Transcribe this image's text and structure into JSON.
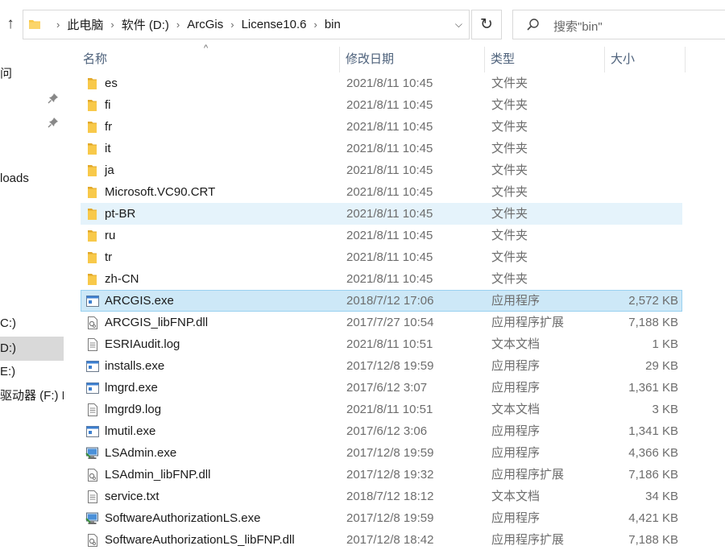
{
  "address_bar": {
    "crumbs": [
      "此电脑",
      "软件 (D:)",
      "ArcGis",
      "License10.6",
      "bin"
    ]
  },
  "search": {
    "placeholder": "搜索\"bin\""
  },
  "nav": {
    "items": [
      {
        "label": "问",
        "selected": false
      },
      {
        "label": "loads",
        "selected": false
      },
      {
        "label": "C:)",
        "selected": false
      },
      {
        "label": "D:)",
        "selected": true
      },
      {
        "label": "E:)",
        "selected": false
      },
      {
        "label": "驱动器 (F:) E",
        "selected": false
      }
    ]
  },
  "columns": {
    "name": "名称",
    "date": "修改日期",
    "type": "类型",
    "size": "大小"
  },
  "files": [
    {
      "name": "es",
      "date": "2021/8/11 10:45",
      "type": "文件夹",
      "size": "",
      "icon": "folder-icon",
      "state": ""
    },
    {
      "name": "fi",
      "date": "2021/8/11 10:45",
      "type": "文件夹",
      "size": "",
      "icon": "folder-icon",
      "state": ""
    },
    {
      "name": "fr",
      "date": "2021/8/11 10:45",
      "type": "文件夹",
      "size": "",
      "icon": "folder-icon",
      "state": ""
    },
    {
      "name": "it",
      "date": "2021/8/11 10:45",
      "type": "文件夹",
      "size": "",
      "icon": "folder-icon",
      "state": ""
    },
    {
      "name": "ja",
      "date": "2021/8/11 10:45",
      "type": "文件夹",
      "size": "",
      "icon": "folder-icon",
      "state": ""
    },
    {
      "name": "Microsoft.VC90.CRT",
      "date": "2021/8/11 10:45",
      "type": "文件夹",
      "size": "",
      "icon": "folder-icon",
      "state": ""
    },
    {
      "name": "pt-BR",
      "date": "2021/8/11 10:45",
      "type": "文件夹",
      "size": "",
      "icon": "folder-icon",
      "state": "hover"
    },
    {
      "name": "ru",
      "date": "2021/8/11 10:45",
      "type": "文件夹",
      "size": "",
      "icon": "folder-icon",
      "state": ""
    },
    {
      "name": "tr",
      "date": "2021/8/11 10:45",
      "type": "文件夹",
      "size": "",
      "icon": "folder-icon",
      "state": ""
    },
    {
      "name": "zh-CN",
      "date": "2021/8/11 10:45",
      "type": "文件夹",
      "size": "",
      "icon": "folder-icon",
      "state": ""
    },
    {
      "name": "ARCGIS.exe",
      "date": "2018/7/12 17:06",
      "type": "应用程序",
      "size": "2,572 KB",
      "icon": "exe-icon",
      "state": "selected"
    },
    {
      "name": "ARCGIS_libFNP.dll",
      "date": "2017/7/27 10:54",
      "type": "应用程序扩展",
      "size": "7,188 KB",
      "icon": "dll-icon",
      "state": ""
    },
    {
      "name": "ESRIAudit.log",
      "date": "2021/8/11 10:51",
      "type": "文本文档",
      "size": "1 KB",
      "icon": "text-file-icon",
      "state": ""
    },
    {
      "name": "installs.exe",
      "date": "2017/12/8 19:59",
      "type": "应用程序",
      "size": "29 KB",
      "icon": "exe-icon",
      "state": ""
    },
    {
      "name": "lmgrd.exe",
      "date": "2017/6/12 3:07",
      "type": "应用程序",
      "size": "1,361 KB",
      "icon": "exe-icon",
      "state": ""
    },
    {
      "name": "lmgrd9.log",
      "date": "2021/8/11 10:51",
      "type": "文本文档",
      "size": "3 KB",
      "icon": "text-file-icon",
      "state": ""
    },
    {
      "name": "lmutil.exe",
      "date": "2017/6/12 3:06",
      "type": "应用程序",
      "size": "1,341 KB",
      "icon": "exe-icon",
      "state": ""
    },
    {
      "name": "LSAdmin.exe",
      "date": "2017/12/8 19:59",
      "type": "应用程序",
      "size": "4,366 KB",
      "icon": "app-monitor-icon",
      "state": ""
    },
    {
      "name": "LSAdmin_libFNP.dll",
      "date": "2017/12/8 19:32",
      "type": "应用程序扩展",
      "size": "7,186 KB",
      "icon": "dll-icon",
      "state": ""
    },
    {
      "name": "service.txt",
      "date": "2018/7/12 18:12",
      "type": "文本文档",
      "size": "34 KB",
      "icon": "text-file-icon",
      "state": ""
    },
    {
      "name": "SoftwareAuthorizationLS.exe",
      "date": "2017/12/8 19:59",
      "type": "应用程序",
      "size": "4,421 KB",
      "icon": "app-monitor-icon",
      "state": ""
    },
    {
      "name": "SoftwareAuthorizationLS_libFNP.dll",
      "date": "2017/12/8 18:42",
      "type": "应用程序扩展",
      "size": "7,188 KB",
      "icon": "dll-icon",
      "state": ""
    }
  ],
  "colors": {
    "folder": "#f8c94a",
    "selected_bg": "#cde8f7",
    "selected_border": "#99d1f0",
    "hover_bg": "#e5f3fb",
    "header_text": "#4c607a"
  }
}
